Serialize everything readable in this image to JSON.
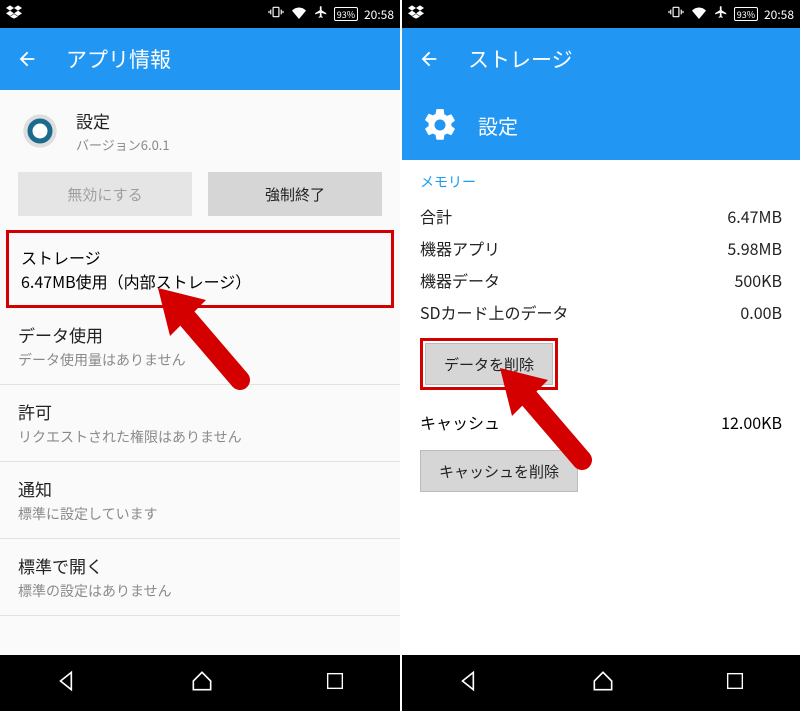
{
  "status": {
    "battery": "93%",
    "time": "20:58"
  },
  "left": {
    "title": "アプリ情報",
    "app_name": "設定",
    "app_version": "バージョン6.0.1",
    "btn_disable": "無効にする",
    "btn_force_stop": "強制終了",
    "storage": {
      "label": "ストレージ",
      "detail": "6.47MB使用（内部ストレージ）"
    },
    "data_usage": {
      "label": "データ使用",
      "detail": "データ使用量はありません"
    },
    "permissions": {
      "label": "許可",
      "detail": "リクエストされた権限はありません"
    },
    "notifications": {
      "label": "通知",
      "detail": "標準に設定しています"
    },
    "open_default": {
      "label": "標準で開く",
      "detail": "標準の設定はありません"
    }
  },
  "right": {
    "title": "ストレージ",
    "app_name": "設定",
    "section": "メモリー",
    "rows": {
      "total": {
        "label": "合計",
        "value": "6.47MB"
      },
      "device_app": {
        "label": "機器アプリ",
        "value": "5.98MB"
      },
      "device_data": {
        "label": "機器データ",
        "value": "500KB"
      },
      "sd_data": {
        "label": "SDカード上のデータ",
        "value": "0.00B"
      }
    },
    "btn_clear_data": "データを削除",
    "cache": {
      "label": "キャッシュ",
      "value": "12.00KB"
    },
    "btn_clear_cache": "キャッシュを削除"
  }
}
